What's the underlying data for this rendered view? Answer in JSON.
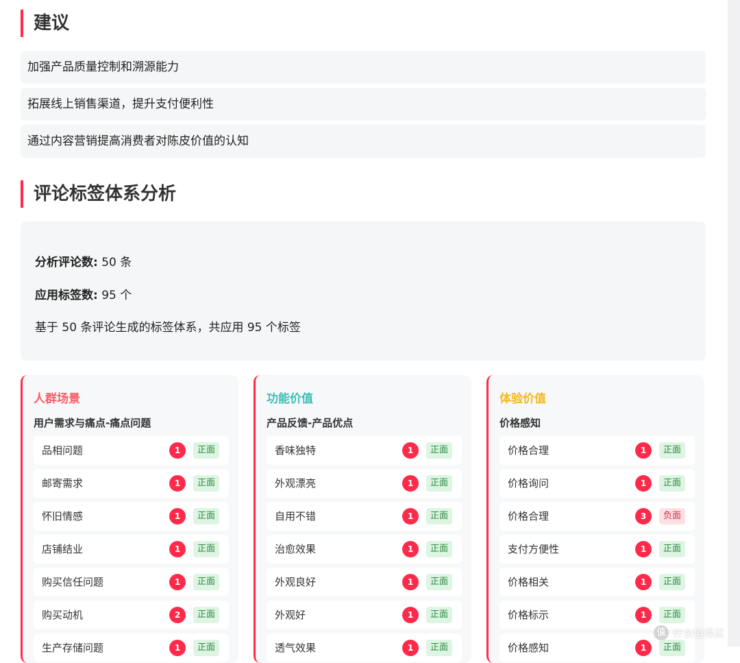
{
  "suggestions_section": {
    "title": "建议",
    "items": [
      "加强产品质量控制和溯源能力",
      "拓展线上销售渠道，提升支付便利性",
      "通过内容营销提高消费者对陈皮价值的认知"
    ]
  },
  "tag_analysis": {
    "title": "评论标签体系分析",
    "stats": {
      "review_count_label": "分析评论数:",
      "review_count_value": "50 条",
      "tag_count_label": "应用标签数:",
      "tag_count_value": "95 个",
      "summary": "基于 50 条评论生成的标签体系，共应用 95 个标签"
    },
    "columns": [
      {
        "title": "人群场景",
        "title_color": "#ff5a67",
        "subtitle": "用户需求与痛点-痛点问题",
        "tags": [
          {
            "name": "品相问题",
            "count": "1",
            "sentiment": "正面"
          },
          {
            "name": "邮寄需求",
            "count": "1",
            "sentiment": "正面"
          },
          {
            "name": "怀旧情感",
            "count": "1",
            "sentiment": "正面"
          },
          {
            "name": "店铺结业",
            "count": "1",
            "sentiment": "正面"
          },
          {
            "name": "购买信任问题",
            "count": "1",
            "sentiment": "正面"
          },
          {
            "name": "购买动机",
            "count": "2",
            "sentiment": "正面"
          },
          {
            "name": "生产存储问题",
            "count": "1",
            "sentiment": "正面"
          }
        ]
      },
      {
        "title": "功能价值",
        "title_color": "#3dbfb4",
        "subtitle": "产品反馈-产品优点",
        "tags": [
          {
            "name": "香味独特",
            "count": "1",
            "sentiment": "正面"
          },
          {
            "name": "外观漂亮",
            "count": "1",
            "sentiment": "正面"
          },
          {
            "name": "自用不错",
            "count": "1",
            "sentiment": "正面"
          },
          {
            "name": "治愈效果",
            "count": "1",
            "sentiment": "正面"
          },
          {
            "name": "外观良好",
            "count": "1",
            "sentiment": "正面"
          },
          {
            "name": "外观好",
            "count": "1",
            "sentiment": "正面"
          },
          {
            "name": "透气效果",
            "count": "1",
            "sentiment": "正面"
          }
        ]
      },
      {
        "title": "体验价值",
        "title_color": "#f5b81c",
        "subtitle": "价格感知",
        "tags": [
          {
            "name": "价格合理",
            "count": "1",
            "sentiment": "正面"
          },
          {
            "name": "价格询问",
            "count": "1",
            "sentiment": "正面"
          },
          {
            "name": "价格合理",
            "count": "3",
            "sentiment": "负面"
          },
          {
            "name": "支付方便性",
            "count": "1",
            "sentiment": "正面"
          },
          {
            "name": "价格相关",
            "count": "1",
            "sentiment": "正面"
          },
          {
            "name": "价格标示",
            "count": "1",
            "sentiment": "正面"
          },
          {
            "name": "价格感知",
            "count": "1",
            "sentiment": "正面"
          }
        ]
      }
    ]
  },
  "watermark": {
    "icon_text": "值",
    "text": "什么值得买"
  },
  "colors": {
    "accent": "#ff2a4a",
    "positive_bg": "#dff5e3",
    "negative_bg": "#fde0e3"
  }
}
